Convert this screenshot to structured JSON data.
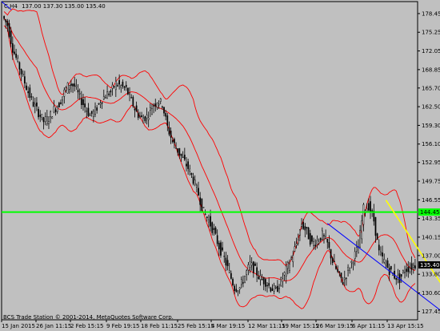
{
  "header": {
    "symbol": "C,H4",
    "ohlc": "137.00 137.30 135.00 135.40"
  },
  "copyright": "BCS Trade Station © 2001-2014, MetaQuotes Software Corp.",
  "colors": {
    "background": "#c0c0c0",
    "candle": "#000000",
    "bands": "#ff0000",
    "level_line": "#00ff00",
    "trend_line_blue": "#0000ff",
    "trend_line_yellow": "#ffff00",
    "price_tag_bg": "#000000",
    "price_tag_fg": "#ffffff"
  },
  "chart_data": {
    "type": "candlestick",
    "timeframe": "H4",
    "y_ticks": [
      "178.45",
      "175.25",
      "172.05",
      "168.85",
      "165.70",
      "162.50",
      "159.30",
      "156.10",
      "152.95",
      "149.75",
      "146.55",
      "143.35",
      "140.15",
      "137.00",
      "133.80",
      "130.60",
      "127.45"
    ],
    "x_ticks": [
      "15 Jan 2015",
      "26 Jan 11:15",
      "2 Feb 15:15",
      "9 Feb 19:15",
      "18 Feb 11:15",
      "25 Feb 15:15",
      "4 Mar 19:15",
      "12 Mar 11:15",
      "19 Mar 15:15",
      "26 Mar 19:15",
      "6 Apr 11:15",
      "13 Apr 15:15"
    ],
    "ylim": [
      126.0,
      180.5
    ],
    "close_path": [
      [
        0,
        178.0
      ],
      [
        3,
        176.5
      ],
      [
        6,
        172.5
      ],
      [
        9,
        170.0
      ],
      [
        12,
        167.5
      ],
      [
        15,
        165.0
      ],
      [
        18,
        163.0
      ],
      [
        21,
        161.5
      ],
      [
        24,
        160.0
      ],
      [
        27,
        160.5
      ],
      [
        30,
        162.0
      ],
      [
        33,
        163.0
      ],
      [
        36,
        165.0
      ],
      [
        39,
        166.5
      ],
      [
        42,
        166.0
      ],
      [
        45,
        164.0
      ],
      [
        48,
        162.5
      ],
      [
        51,
        161.0
      ],
      [
        54,
        161.8
      ],
      [
        57,
        163.5
      ],
      [
        60,
        164.5
      ],
      [
        63,
        165.0
      ],
      [
        66,
        166.5
      ],
      [
        69,
        166.0
      ],
      [
        72,
        165.5
      ],
      [
        75,
        163.5
      ],
      [
        78,
        161.5
      ],
      [
        81,
        160.5
      ],
      [
        84,
        160.8
      ],
      [
        87,
        162.5
      ],
      [
        90,
        163.5
      ],
      [
        93,
        163.0
      ],
      [
        96,
        159.0
      ],
      [
        99,
        156.5
      ],
      [
        102,
        155.0
      ],
      [
        105,
        153.5
      ],
      [
        108,
        152.0
      ],
      [
        111,
        150.0
      ],
      [
        114,
        147.5
      ],
      [
        117,
        144.5
      ],
      [
        120,
        143.0
      ],
      [
        123,
        141.0
      ],
      [
        126,
        138.5
      ],
      [
        129,
        136.5
      ],
      [
        132,
        134.0
      ],
      [
        135,
        131.5
      ],
      [
        138,
        131.5
      ],
      [
        141,
        133.5
      ],
      [
        144,
        135.5
      ],
      [
        147,
        134.5
      ],
      [
        150,
        133.0
      ],
      [
        153,
        132.5
      ],
      [
        156,
        131.5
      ],
      [
        159,
        131.0
      ],
      [
        162,
        132.5
      ],
      [
        165,
        134.5
      ],
      [
        168,
        136.5
      ],
      [
        171,
        139.0
      ],
      [
        174,
        142.5
      ],
      [
        177,
        141.0
      ],
      [
        180,
        139.0
      ],
      [
        183,
        139.5
      ],
      [
        186,
        140.5
      ],
      [
        189,
        139.0
      ],
      [
        192,
        136.0
      ],
      [
        195,
        134.0
      ],
      [
        198,
        132.5
      ],
      [
        201,
        134.5
      ],
      [
        204,
        136.5
      ],
      [
        207,
        138.5
      ],
      [
        210,
        145.0
      ],
      [
        213,
        145.5
      ],
      [
        216,
        143.0
      ],
      [
        219,
        137.5
      ],
      [
        222,
        136.0
      ],
      [
        225,
        134.5
      ],
      [
        228,
        133.5
      ],
      [
        231,
        133.0
      ],
      [
        234,
        134.5
      ],
      [
        237,
        135.0
      ],
      [
        240,
        135.4
      ]
    ],
    "horizontal_level": 144.45,
    "current_price": "135.40",
    "level_label": "144.45",
    "bands_period": 20,
    "trend_lines": [
      {
        "color": "blue",
        "from": [
          188,
          142.5
        ],
        "to": [
          260,
          126.2
        ]
      },
      {
        "color": "yellow",
        "from": [
          222,
          146.5
        ],
        "to": [
          259,
          130.0
        ]
      }
    ],
    "grid": false,
    "legend": "none"
  }
}
